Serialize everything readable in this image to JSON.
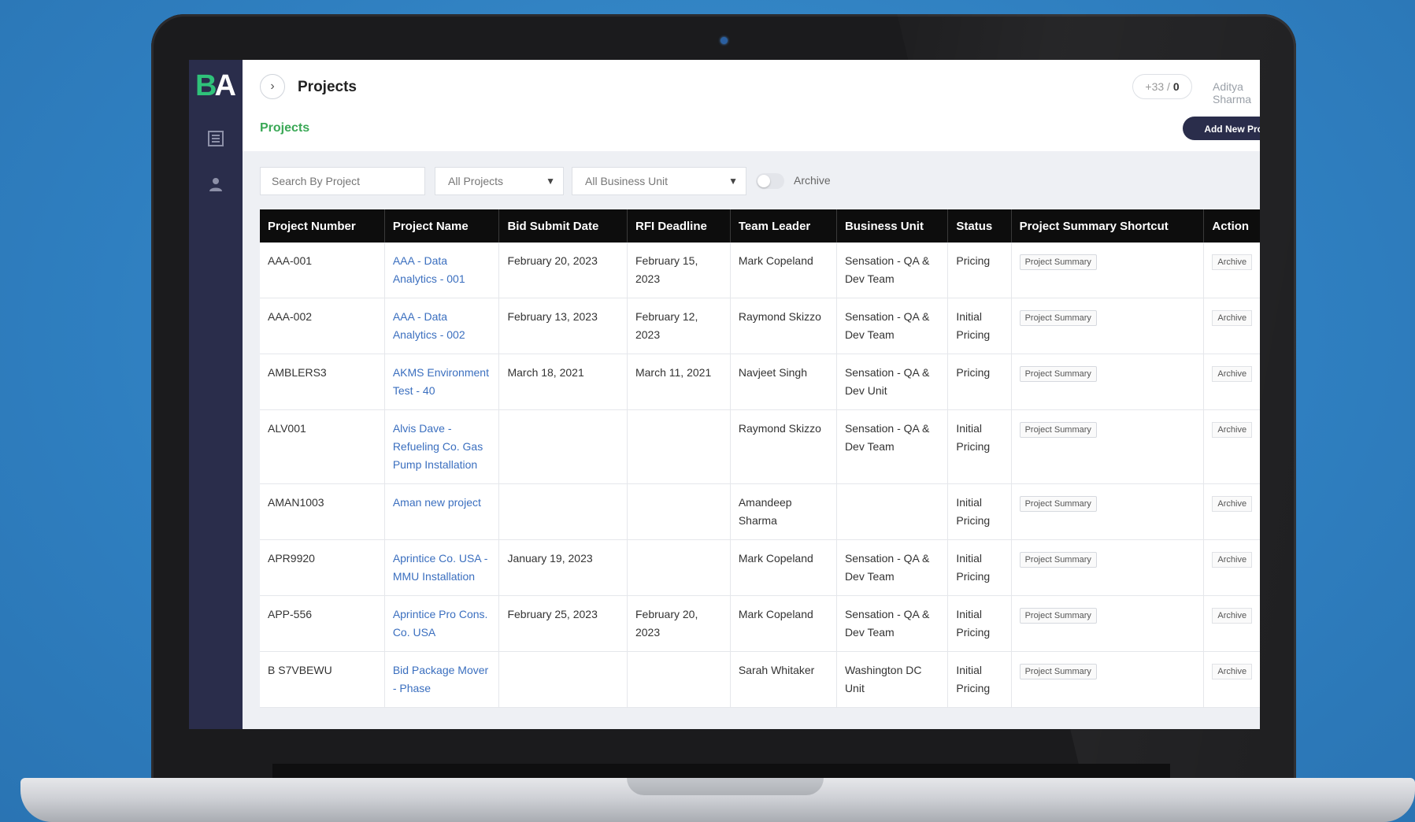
{
  "app": {
    "logo_letters": [
      "B",
      "A"
    ],
    "page_title": "Projects",
    "breadcrumb": "Projects",
    "counter_prefix": "+33 / ",
    "counter_value": "0",
    "user_name": "Aditya Sharma",
    "add_button_label": "Add New Project"
  },
  "sidebar": {
    "icons": [
      "list-icon",
      "users-icon"
    ]
  },
  "filters": {
    "search_placeholder": "Search By Project",
    "projects_select": "All Projects",
    "business_unit_select": "All Business Unit",
    "archive_toggle_label": "Archive"
  },
  "table": {
    "columns": [
      "Project Number",
      "Project Name",
      "Bid Submit Date",
      "RFI Deadline",
      "Team Leader",
      "Business Unit",
      "Status",
      "Project Summary Shortcut",
      "Action"
    ],
    "summary_label": "Project Summary",
    "archive_label": "Archive",
    "rows": [
      {
        "number": "AAA-001",
        "name": "AAA - Data Analytics - 001",
        "bid_date": "February 20, 2023",
        "rfi": "February 15, 2023",
        "leader": "Mark Copeland",
        "unit": "Sensation - QA & Dev Team",
        "status": "Pricing"
      },
      {
        "number": "AAA-002",
        "name": "AAA - Data Analytics - 002",
        "bid_date": "February 13, 2023",
        "rfi": "February 12, 2023",
        "leader": "Raymond Skizzo",
        "unit": "Sensation - QA & Dev Team",
        "status": "Initial Pricing"
      },
      {
        "number": "AMBLERS3",
        "name": "AKMS Environment Test - 40",
        "bid_date": "March 18, 2021",
        "rfi": "March 11, 2021",
        "leader": "Navjeet Singh",
        "unit": "Sensation - QA & Dev Unit",
        "status": "Pricing"
      },
      {
        "number": "ALV001",
        "name": "Alvis Dave - Refueling Co. Gas Pump Installation",
        "bid_date": "",
        "rfi": "",
        "leader": "Raymond Skizzo",
        "unit": "Sensation - QA & Dev Team",
        "status": "Initial Pricing"
      },
      {
        "number": "AMAN1003",
        "name": "Aman new project",
        "bid_date": "",
        "rfi": "",
        "leader": "Amandeep Sharma",
        "unit": "",
        "status": "Initial Pricing"
      },
      {
        "number": "APR9920",
        "name": "Aprintice Co. USA - MMU Installation",
        "bid_date": "January 19, 2023",
        "rfi": "",
        "leader": "Mark Copeland",
        "unit": "Sensation - QA & Dev Team",
        "status": "Initial Pricing"
      },
      {
        "number": "APP-556",
        "name": "Aprintice Pro Cons. Co. USA",
        "bid_date": "February 25, 2023",
        "rfi": "February 20, 2023",
        "leader": "Mark Copeland",
        "unit": "Sensation - QA & Dev Team",
        "status": "Initial Pricing"
      },
      {
        "number": "B S7VBEWU",
        "name": "Bid Package Mover - Phase",
        "bid_date": "",
        "rfi": "",
        "leader": "Sarah Whitaker",
        "unit": "Washington DC Unit",
        "status": "Initial Pricing"
      }
    ]
  }
}
